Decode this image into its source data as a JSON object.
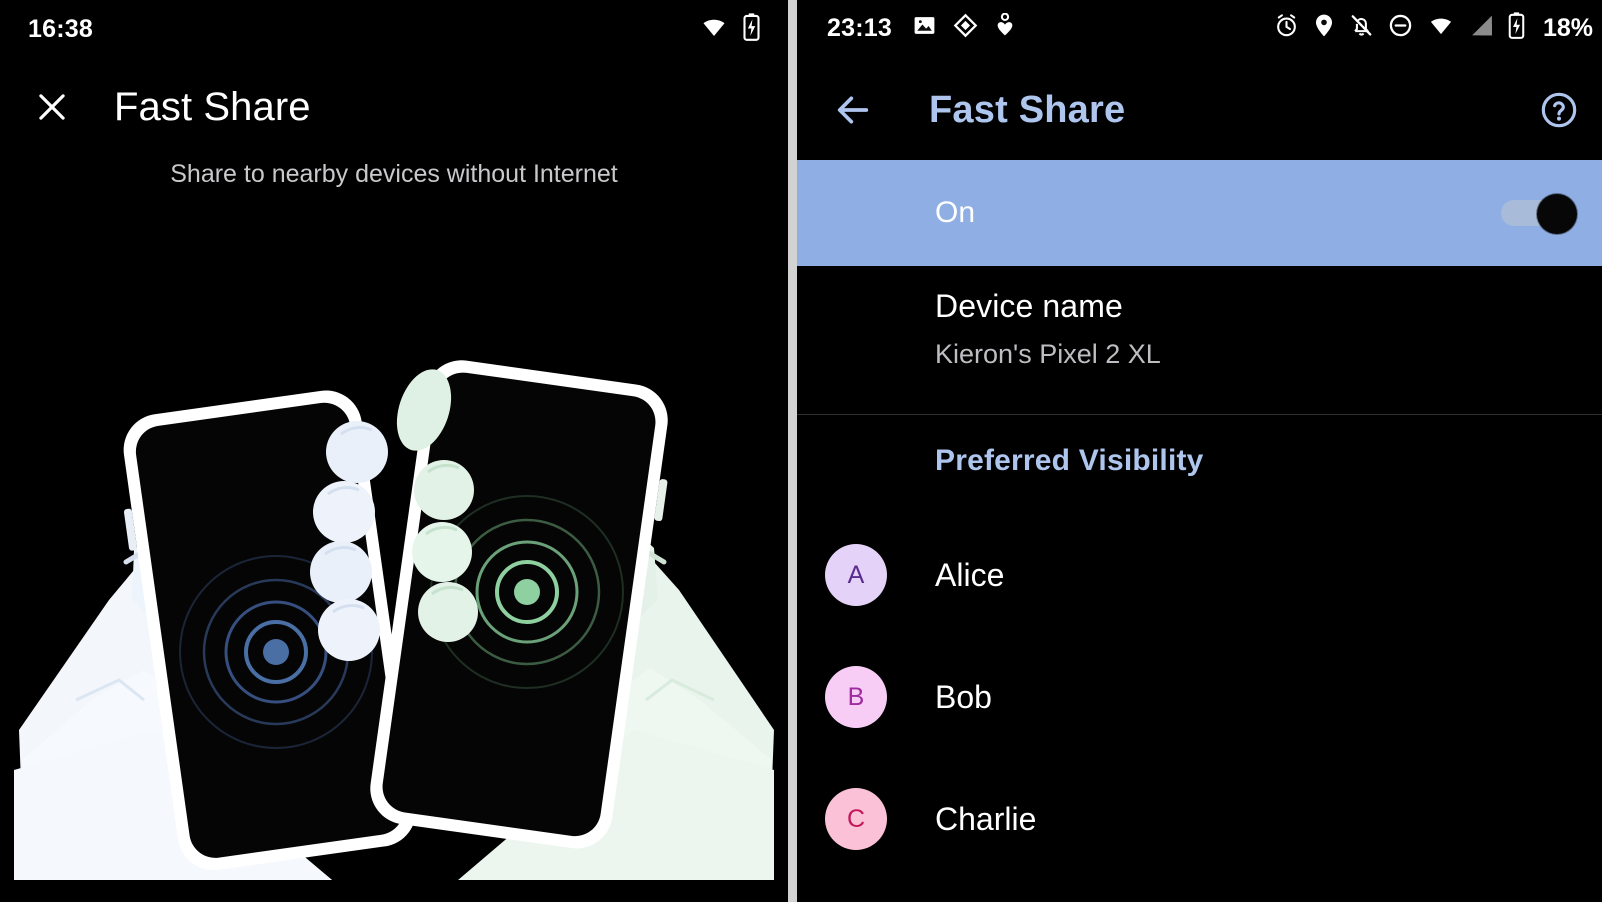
{
  "left_panel": {
    "status_bar": {
      "clock": "16:38",
      "icons": [
        "wifi-icon",
        "battery-charging-icon"
      ]
    },
    "app_bar": {
      "close_icon": "close-icon",
      "title": "Fast Share"
    },
    "subtitle": "Share to nearby devices without Internet",
    "illustration": {
      "name": "two-phones-sharing-illustration",
      "left_phone_accent": "#4a6fa5",
      "right_phone_accent": "#8fd0a0",
      "left_hand_color": "#f2f6fb",
      "right_hand_color": "#e4f2e6"
    }
  },
  "right_panel": {
    "status_bar": {
      "clock": "23:13",
      "left_icons": [
        "image-icon",
        "diamond-icon",
        "heart-person-icon"
      ],
      "right_icons": [
        "alarm-icon",
        "location-icon",
        "notifications-off-icon",
        "do-not-disturb-icon",
        "wifi-icon",
        "signal-icon",
        "battery-charging-icon"
      ],
      "battery_percent": "18%"
    },
    "app_bar": {
      "back_icon": "back-arrow-icon",
      "title": "Fast Share",
      "help_icon": "help-circle-icon",
      "title_color": "#aec5ee"
    },
    "toggle_row": {
      "label": "On",
      "state": "on",
      "background_color": "#8fafe4",
      "thumb_color": "#070707"
    },
    "device_name": {
      "label": "Device name",
      "value": "Kieron's Pixel 2 XL"
    },
    "preferred_visibility": {
      "title": "Preferred Visibility",
      "contacts": [
        {
          "initial": "A",
          "name": "Alice",
          "avatar_bg": "#e5d2f8",
          "avatar_fg": "#5b2d8e"
        },
        {
          "initial": "B",
          "name": "Bob",
          "avatar_bg": "#f7cdf6",
          "avatar_fg": "#a02aa0"
        },
        {
          "initial": "C",
          "name": "Charlie",
          "avatar_bg": "#fbc1d6",
          "avatar_fg": "#c2185b"
        }
      ]
    }
  }
}
